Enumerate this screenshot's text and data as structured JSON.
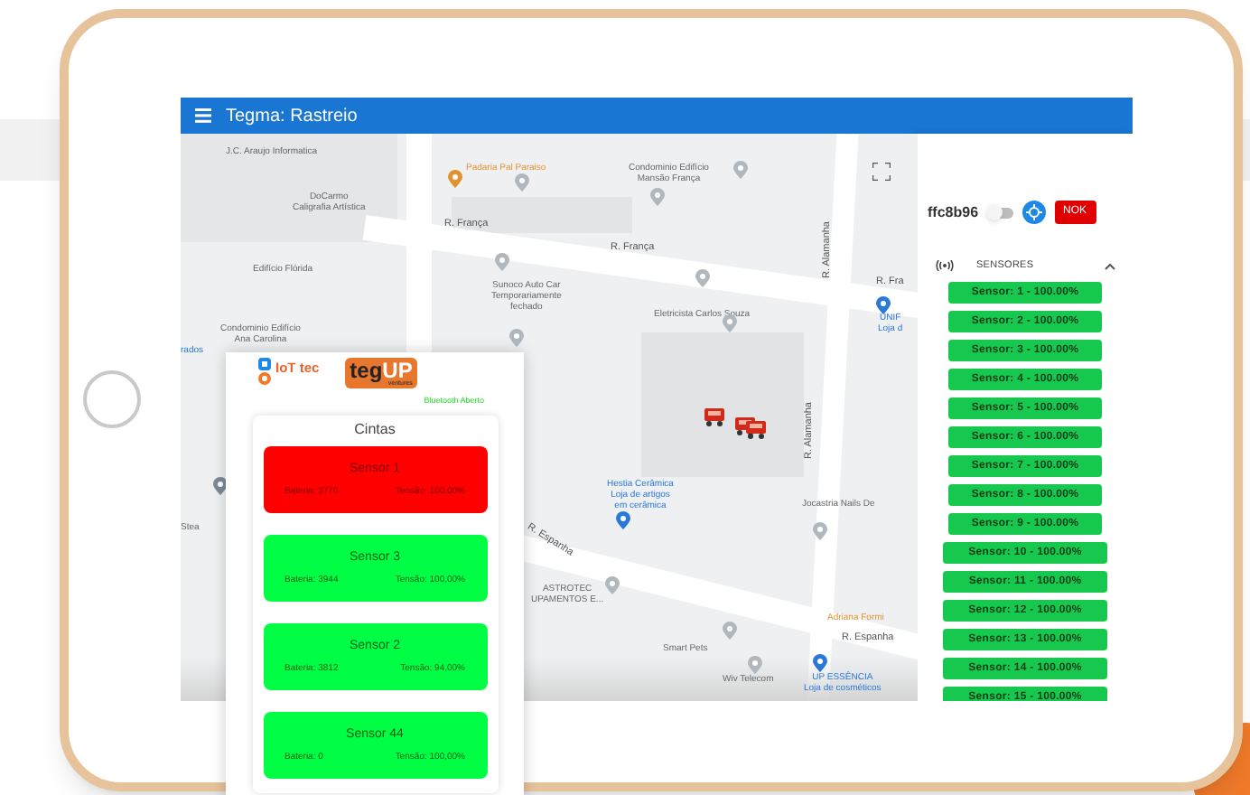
{
  "app_bar": {
    "title": "Tegma: Rastreio"
  },
  "map": {
    "labels": [
      {
        "text": "J.C. Araujo Informatica",
        "kind": "place"
      },
      {
        "text": "DoCarmo\nCaligrafia Artística",
        "kind": "place"
      },
      {
        "text": "Edifício Flórida",
        "kind": "place"
      },
      {
        "text": "Condominio Edifício\nAna Carolina",
        "kind": "place"
      },
      {
        "text": "rados",
        "kind": "shop"
      },
      {
        "text": "Padaria Pal Paraiso",
        "kind": "food"
      },
      {
        "text": "Condominio Edifício\nMansão França",
        "kind": "place"
      },
      {
        "text": "R. França",
        "kind": "street"
      },
      {
        "text": "R. França",
        "kind": "street"
      },
      {
        "text": "Sunoco Auto Car\nTemporariamente\nfechado",
        "kind": "place"
      },
      {
        "text": "Eletricista Carlos Souza",
        "kind": "place"
      },
      {
        "text": "R. Alamanha",
        "kind": "vstreet"
      },
      {
        "text": "R. Fra",
        "kind": "street"
      },
      {
        "text": "UNIF\nLoja d",
        "kind": "shop"
      },
      {
        "text": "Stea",
        "kind": "place"
      },
      {
        "text": "Hestia Cerâmica\nLoja de artigos\nem cerâmica",
        "kind": "shop"
      },
      {
        "text": "R. Espanha",
        "kind": "dstreet"
      },
      {
        "text": "ASTROTEC\nUPAMENTOS E...",
        "kind": "place"
      },
      {
        "text": "Jocastria Nails De",
        "kind": "place"
      },
      {
        "text": "Adriana Formi",
        "kind": "food"
      },
      {
        "text": "R. Espanha",
        "kind": "street"
      },
      {
        "text": "Smart Pets",
        "kind": "place"
      },
      {
        "text": "Wiv Telecom",
        "kind": "place"
      },
      {
        "text": "UP ESSÊNCIA\nLoja de cosméticos",
        "kind": "shop"
      },
      {
        "text": "R. Alamanha",
        "kind": "vstreet"
      }
    ]
  },
  "panel": {
    "device_id": "ffc8b96",
    "toggle_on": false,
    "status_button": "NOK",
    "section_title": "SENSORES",
    "expanded": true,
    "sensors": [
      "Sensor: 1 - 100.00%",
      "Sensor: 2 - 100.00%",
      "Sensor: 3 - 100.00%",
      "Sensor: 4 - 100.00%",
      "Sensor: 5 - 100.00%",
      "Sensor: 6 - 100.00%",
      "Sensor: 7 - 100.00%",
      "Sensor: 8 - 100.00%",
      "Sensor: 9 - 100.00%",
      "Sensor: 10 - 100.00%",
      "Sensor: 11 - 100.00%",
      "Sensor: 12 - 100.00%",
      "Sensor: 13 - 100.00%",
      "Sensor: 14 - 100.00%",
      "Sensor: 15 - 100.00%"
    ]
  },
  "phone": {
    "logo_left": "IoT tec",
    "logo_right": {
      "main": "teg",
      "accent": "UP",
      "sub": "ventures"
    },
    "status": "Bluetooth Aberto",
    "card_title": "Cintas",
    "sensors": [
      {
        "name": "Sensor 1",
        "alarm": true,
        "battery": "Bateria: 3770",
        "tension": "Tensão: 100,00%"
      },
      {
        "name": "Sensor 3",
        "alarm": false,
        "battery": "Bateria: 3944",
        "tension": "Tensão: 100,00%"
      },
      {
        "name": "Sensor 2",
        "alarm": false,
        "battery": "Bateria: 3812",
        "tension": "Tensão: 94,00%"
      },
      {
        "name": "Sensor 44",
        "alarm": false,
        "battery": "Bateria: 0",
        "tension": "Tensão: 100,00%"
      }
    ]
  }
}
